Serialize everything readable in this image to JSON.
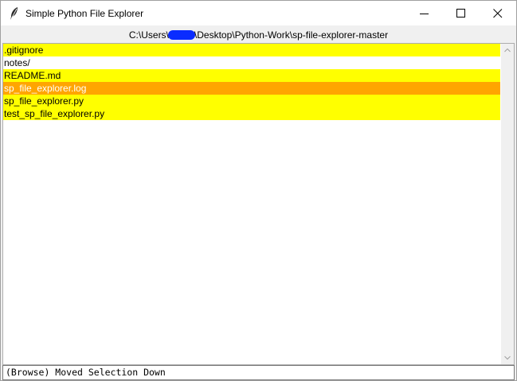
{
  "window": {
    "title": "Simple Python File Explorer"
  },
  "path": {
    "prefix": "C:\\Users\\",
    "suffix": "\\Desktop\\Python-Work\\sp-file-explorer-master"
  },
  "files": [
    {
      "name": ".gitignore",
      "highlighted": true,
      "selected": false
    },
    {
      "name": "notes/",
      "highlighted": false,
      "selected": false
    },
    {
      "name": "README.md",
      "highlighted": true,
      "selected": false
    },
    {
      "name": "sp_file_explorer.log",
      "highlighted": true,
      "selected": true
    },
    {
      "name": "sp_file_explorer.py",
      "highlighted": true,
      "selected": false
    },
    {
      "name": "test_sp_file_explorer.py",
      "highlighted": true,
      "selected": false
    }
  ],
  "status": {
    "text": "(Browse) Moved Selection Down"
  },
  "colors": {
    "highlight": "#ffff00",
    "selection": "#ffa500",
    "redaction": "#0a2cff"
  }
}
